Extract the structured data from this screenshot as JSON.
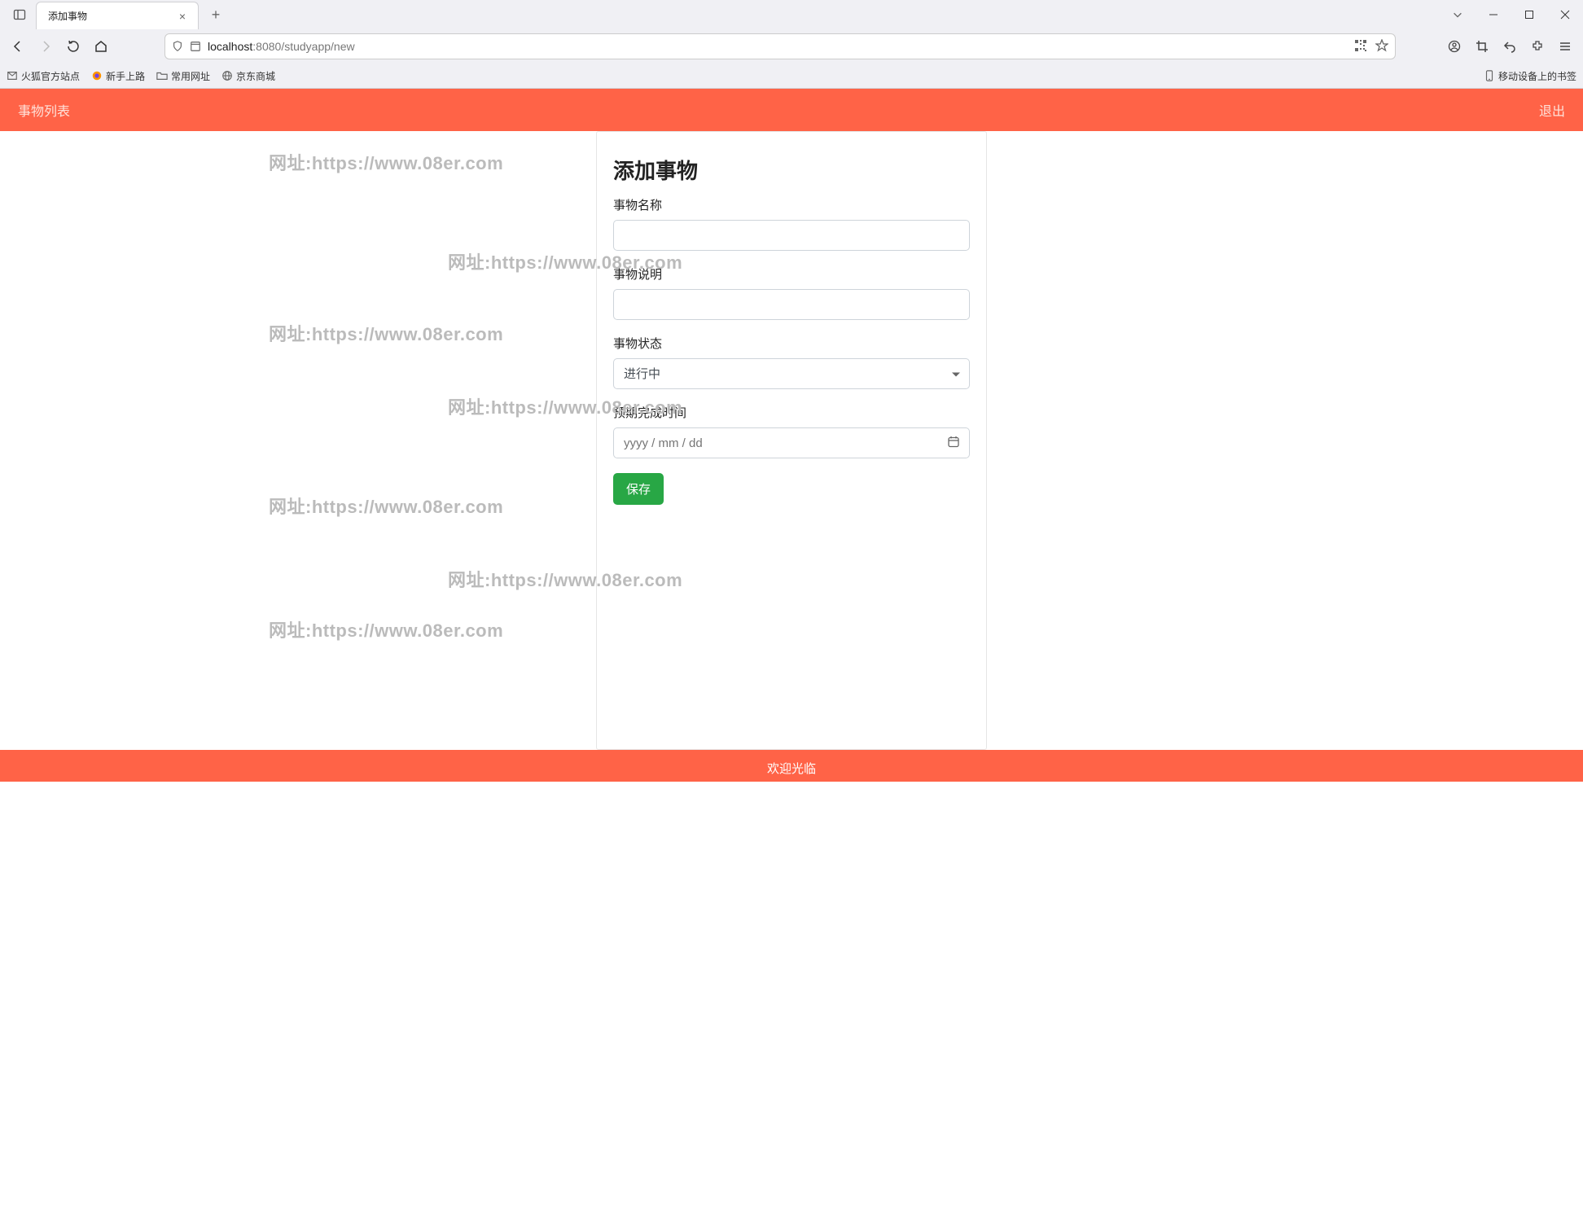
{
  "browser": {
    "tab_title": "添加事物",
    "url_host": "localhost",
    "url_port": ":8080",
    "url_path": "/studyapp/new",
    "bookmarks": {
      "b1": "火狐官方站点",
      "b2": "新手上路",
      "b3": "常用网址",
      "b4": "京东商城",
      "mobile": "移动设备上的书签"
    }
  },
  "page": {
    "nav_left": "事物列表",
    "nav_right": "退出",
    "form": {
      "title": "添加事物",
      "name_label": "事物名称",
      "desc_label": "事物说明",
      "status_label": "事物状态",
      "status_value": "进行中",
      "date_label": "预期完成时间",
      "date_placeholder": "yyyy / mm / dd",
      "save_button": "保存"
    },
    "footer": "欢迎光临",
    "watermark": "网址:https://www.08er.com"
  }
}
